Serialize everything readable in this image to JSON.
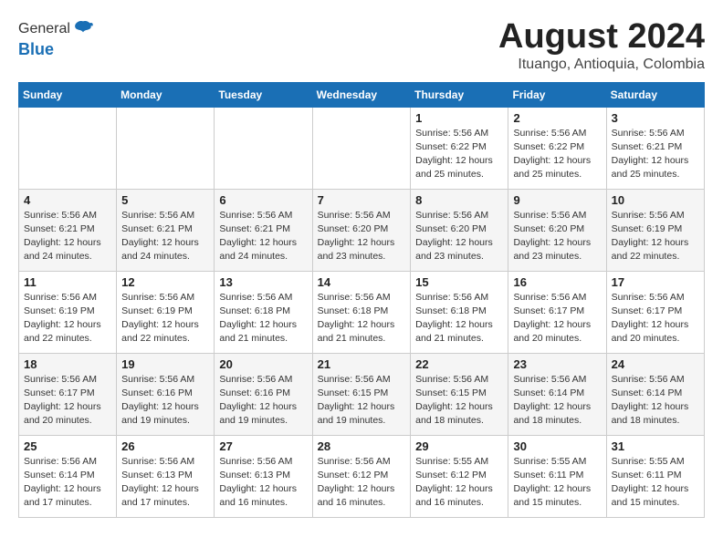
{
  "header": {
    "logo_general": "General",
    "logo_blue": "Blue",
    "month_year": "August 2024",
    "location": "Ituango, Antioquia, Colombia"
  },
  "calendar": {
    "weekdays": [
      "Sunday",
      "Monday",
      "Tuesday",
      "Wednesday",
      "Thursday",
      "Friday",
      "Saturday"
    ],
    "weeks": [
      [
        {
          "day": "",
          "info": ""
        },
        {
          "day": "",
          "info": ""
        },
        {
          "day": "",
          "info": ""
        },
        {
          "day": "",
          "info": ""
        },
        {
          "day": "1",
          "info": "Sunrise: 5:56 AM\nSunset: 6:22 PM\nDaylight: 12 hours\nand 25 minutes."
        },
        {
          "day": "2",
          "info": "Sunrise: 5:56 AM\nSunset: 6:22 PM\nDaylight: 12 hours\nand 25 minutes."
        },
        {
          "day": "3",
          "info": "Sunrise: 5:56 AM\nSunset: 6:21 PM\nDaylight: 12 hours\nand 25 minutes."
        }
      ],
      [
        {
          "day": "4",
          "info": "Sunrise: 5:56 AM\nSunset: 6:21 PM\nDaylight: 12 hours\nand 24 minutes."
        },
        {
          "day": "5",
          "info": "Sunrise: 5:56 AM\nSunset: 6:21 PM\nDaylight: 12 hours\nand 24 minutes."
        },
        {
          "day": "6",
          "info": "Sunrise: 5:56 AM\nSunset: 6:21 PM\nDaylight: 12 hours\nand 24 minutes."
        },
        {
          "day": "7",
          "info": "Sunrise: 5:56 AM\nSunset: 6:20 PM\nDaylight: 12 hours\nand 23 minutes."
        },
        {
          "day": "8",
          "info": "Sunrise: 5:56 AM\nSunset: 6:20 PM\nDaylight: 12 hours\nand 23 minutes."
        },
        {
          "day": "9",
          "info": "Sunrise: 5:56 AM\nSunset: 6:20 PM\nDaylight: 12 hours\nand 23 minutes."
        },
        {
          "day": "10",
          "info": "Sunrise: 5:56 AM\nSunset: 6:19 PM\nDaylight: 12 hours\nand 22 minutes."
        }
      ],
      [
        {
          "day": "11",
          "info": "Sunrise: 5:56 AM\nSunset: 6:19 PM\nDaylight: 12 hours\nand 22 minutes."
        },
        {
          "day": "12",
          "info": "Sunrise: 5:56 AM\nSunset: 6:19 PM\nDaylight: 12 hours\nand 22 minutes."
        },
        {
          "day": "13",
          "info": "Sunrise: 5:56 AM\nSunset: 6:18 PM\nDaylight: 12 hours\nand 21 minutes."
        },
        {
          "day": "14",
          "info": "Sunrise: 5:56 AM\nSunset: 6:18 PM\nDaylight: 12 hours\nand 21 minutes."
        },
        {
          "day": "15",
          "info": "Sunrise: 5:56 AM\nSunset: 6:18 PM\nDaylight: 12 hours\nand 21 minutes."
        },
        {
          "day": "16",
          "info": "Sunrise: 5:56 AM\nSunset: 6:17 PM\nDaylight: 12 hours\nand 20 minutes."
        },
        {
          "day": "17",
          "info": "Sunrise: 5:56 AM\nSunset: 6:17 PM\nDaylight: 12 hours\nand 20 minutes."
        }
      ],
      [
        {
          "day": "18",
          "info": "Sunrise: 5:56 AM\nSunset: 6:17 PM\nDaylight: 12 hours\nand 20 minutes."
        },
        {
          "day": "19",
          "info": "Sunrise: 5:56 AM\nSunset: 6:16 PM\nDaylight: 12 hours\nand 19 minutes."
        },
        {
          "day": "20",
          "info": "Sunrise: 5:56 AM\nSunset: 6:16 PM\nDaylight: 12 hours\nand 19 minutes."
        },
        {
          "day": "21",
          "info": "Sunrise: 5:56 AM\nSunset: 6:15 PM\nDaylight: 12 hours\nand 19 minutes."
        },
        {
          "day": "22",
          "info": "Sunrise: 5:56 AM\nSunset: 6:15 PM\nDaylight: 12 hours\nand 18 minutes."
        },
        {
          "day": "23",
          "info": "Sunrise: 5:56 AM\nSunset: 6:14 PM\nDaylight: 12 hours\nand 18 minutes."
        },
        {
          "day": "24",
          "info": "Sunrise: 5:56 AM\nSunset: 6:14 PM\nDaylight: 12 hours\nand 18 minutes."
        }
      ],
      [
        {
          "day": "25",
          "info": "Sunrise: 5:56 AM\nSunset: 6:14 PM\nDaylight: 12 hours\nand 17 minutes."
        },
        {
          "day": "26",
          "info": "Sunrise: 5:56 AM\nSunset: 6:13 PM\nDaylight: 12 hours\nand 17 minutes."
        },
        {
          "day": "27",
          "info": "Sunrise: 5:56 AM\nSunset: 6:13 PM\nDaylight: 12 hours\nand 16 minutes."
        },
        {
          "day": "28",
          "info": "Sunrise: 5:56 AM\nSunset: 6:12 PM\nDaylight: 12 hours\nand 16 minutes."
        },
        {
          "day": "29",
          "info": "Sunrise: 5:55 AM\nSunset: 6:12 PM\nDaylight: 12 hours\nand 16 minutes."
        },
        {
          "day": "30",
          "info": "Sunrise: 5:55 AM\nSunset: 6:11 PM\nDaylight: 12 hours\nand 15 minutes."
        },
        {
          "day": "31",
          "info": "Sunrise: 5:55 AM\nSunset: 6:11 PM\nDaylight: 12 hours\nand 15 minutes."
        }
      ]
    ]
  }
}
